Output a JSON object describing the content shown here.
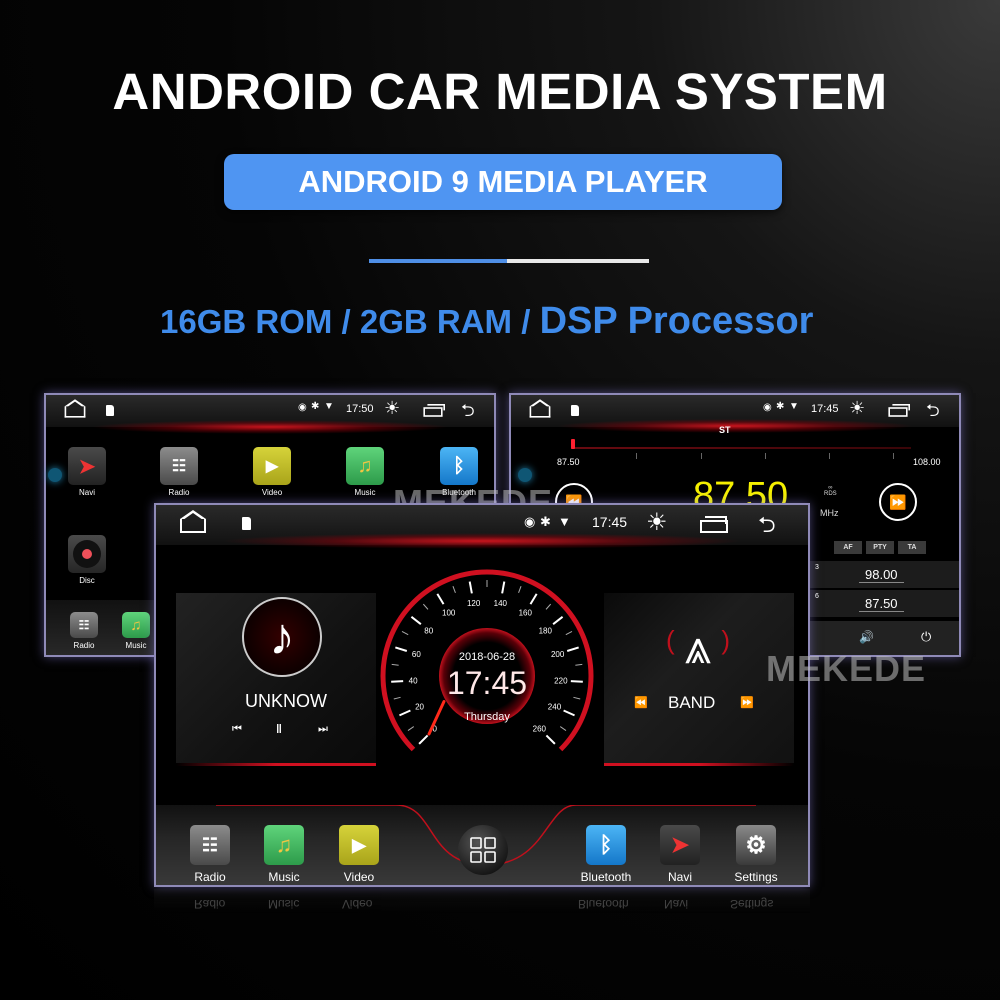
{
  "header": {
    "title": "ANDROID CAR MEDIA SYSTEM",
    "subtitle": "ANDROID 9 MEDIA PLAYER",
    "specs_part1": "16GB ROM / 2GB RAM / ",
    "specs_part2": "DSP Processor"
  },
  "colors": {
    "accent_blue": "#4f95f2",
    "specs_blue": "#3f8bea",
    "red_glow": "#dc141e",
    "freq_yellow": "#f5f000"
  },
  "watermark": "MEKEDE",
  "screen_left": {
    "status": {
      "time": "17:50",
      "icons": [
        "home-icon",
        "sd-card-icon",
        "location-icon",
        "bluetooth-icon",
        "wifi-icon",
        "brightness-icon",
        "recent-apps-icon",
        "back-icon"
      ]
    },
    "apps": [
      {
        "label": "Navi",
        "icon": "compass-icon"
      },
      {
        "label": "Radio",
        "icon": "radio-icon"
      },
      {
        "label": "Video",
        "icon": "video-icon"
      },
      {
        "label": "Music",
        "icon": "music-icon"
      },
      {
        "label": "Bluetooth",
        "icon": "bluetooth-icon"
      },
      {
        "label": "Disc",
        "icon": "disc-icon"
      }
    ],
    "dock": [
      {
        "label": "Radio",
        "icon": "radio-icon"
      },
      {
        "label": "Music",
        "icon": "music-icon"
      }
    ]
  },
  "screen_right": {
    "status": {
      "time": "17:45"
    },
    "stereo": "ST",
    "range_min": "87.50",
    "range_max": "108.00",
    "tuned_position": 0.0,
    "frequency": "87.50",
    "unit": "MHz",
    "rds": "RDS",
    "buttons": [
      "AF",
      "PTY",
      "TA"
    ],
    "presets": [
      {
        "num": "3",
        "freq": "98.00"
      },
      {
        "num": "6",
        "freq": "87.50"
      }
    ]
  },
  "screen_main": {
    "status": {
      "time": "17:45"
    },
    "music": {
      "title": "UNKNOW",
      "controls": [
        "previous-icon",
        "pause-icon",
        "next-icon"
      ]
    },
    "clock": {
      "date": "2018-06-28",
      "time": "17:45",
      "day": "Thursday",
      "speed_ticks": [
        "0",
        "20",
        "40",
        "60",
        "80",
        "100",
        "120",
        "140",
        "160",
        "180",
        "200",
        "220",
        "240",
        "260"
      ],
      "speed_value": 0
    },
    "radio": {
      "label": "BAND"
    },
    "dock": [
      {
        "label": "Radio",
        "icon": "radio-icon"
      },
      {
        "label": "Music",
        "icon": "music-icon"
      },
      {
        "label": "Video",
        "icon": "video-icon"
      },
      {
        "label": "Bluetooth",
        "icon": "bluetooth-icon"
      },
      {
        "label": "Navi",
        "icon": "compass-icon"
      },
      {
        "label": "Settings",
        "icon": "settings-icon"
      }
    ]
  }
}
